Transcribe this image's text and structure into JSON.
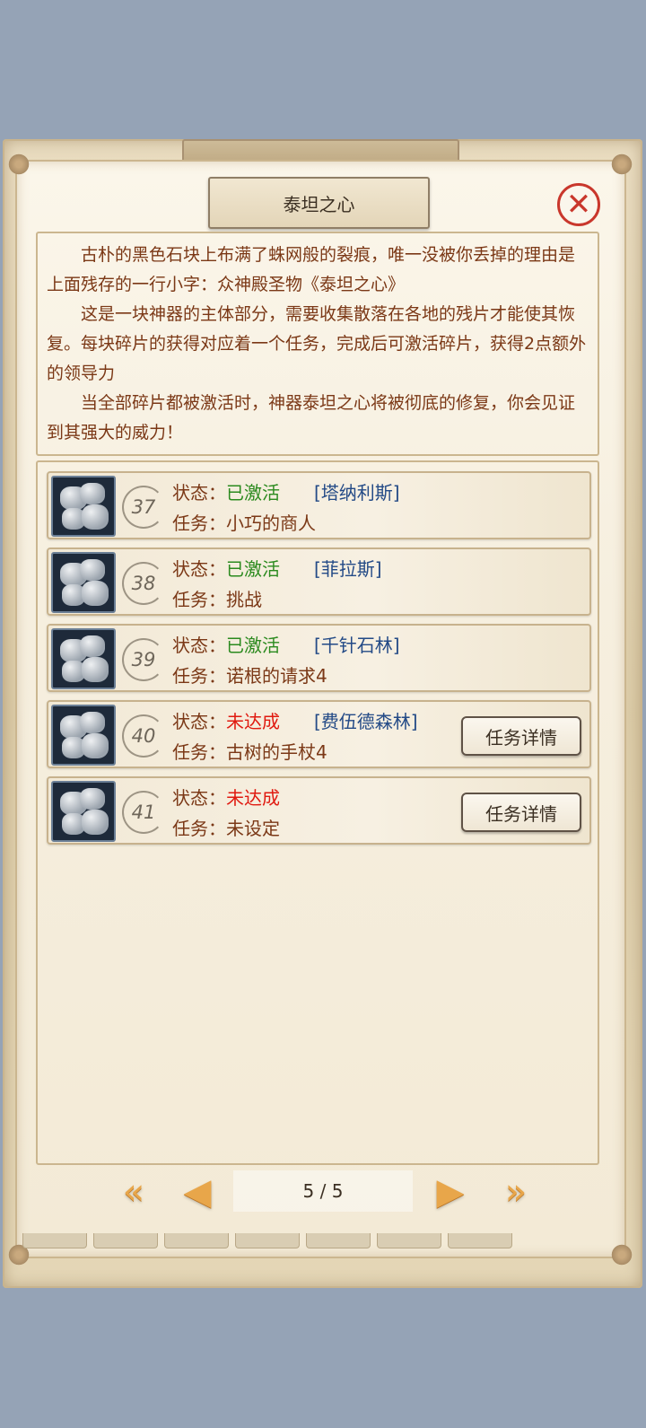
{
  "window": {
    "title": "泰坦之心"
  },
  "description": [
    "古朴的黑色石块上布满了蛛网般的裂痕，唯一没被你丢掉的理由是上面残存的一行小字：众神殿圣物《泰坦之心》",
    "这是一块神器的主体部分，需要收集散落在各地的残片才能使其恢复。每块碎片的获得对应着一个任务，完成后可激活碎片，获得2点额外的领导力",
    "当全部碎片都被激活时，神器泰坦之心将被彻底的修复，你会见证到其强大的威力！"
  ],
  "labels": {
    "status": "状态：",
    "task": "任务："
  },
  "rows": [
    {
      "number": "37",
      "status": "已激活",
      "status_type": "activated",
      "location": "[塔纳利斯]",
      "task": "小巧的商人",
      "button": ""
    },
    {
      "number": "38",
      "status": "已激活",
      "status_type": "activated",
      "location": "[菲拉斯]",
      "task": "挑战",
      "button": ""
    },
    {
      "number": "39",
      "status": "已激活",
      "status_type": "activated",
      "location": "[千针石林]",
      "task": "诺根的请求4",
      "button": ""
    },
    {
      "number": "40",
      "status": "未达成",
      "status_type": "pending",
      "location": "[费伍德森林]",
      "task": "古树的手杖4",
      "button": "任务详情"
    },
    {
      "number": "41",
      "status": "未达成",
      "status_type": "pending",
      "location": "",
      "task": "未设定",
      "button": "任务详情"
    }
  ],
  "pagination": {
    "text": "5 / 5",
    "first_icon": "double-chevron-left-icon",
    "prev_icon": "triangle-left-icon",
    "next_icon": "triangle-right-icon",
    "last_icon": "double-chevron-right-icon"
  },
  "colors": {
    "activated": "#2b8a1e",
    "pending": "#e01a10",
    "location": "#234a86",
    "label": "#7b3816",
    "close": "#c9372c"
  }
}
